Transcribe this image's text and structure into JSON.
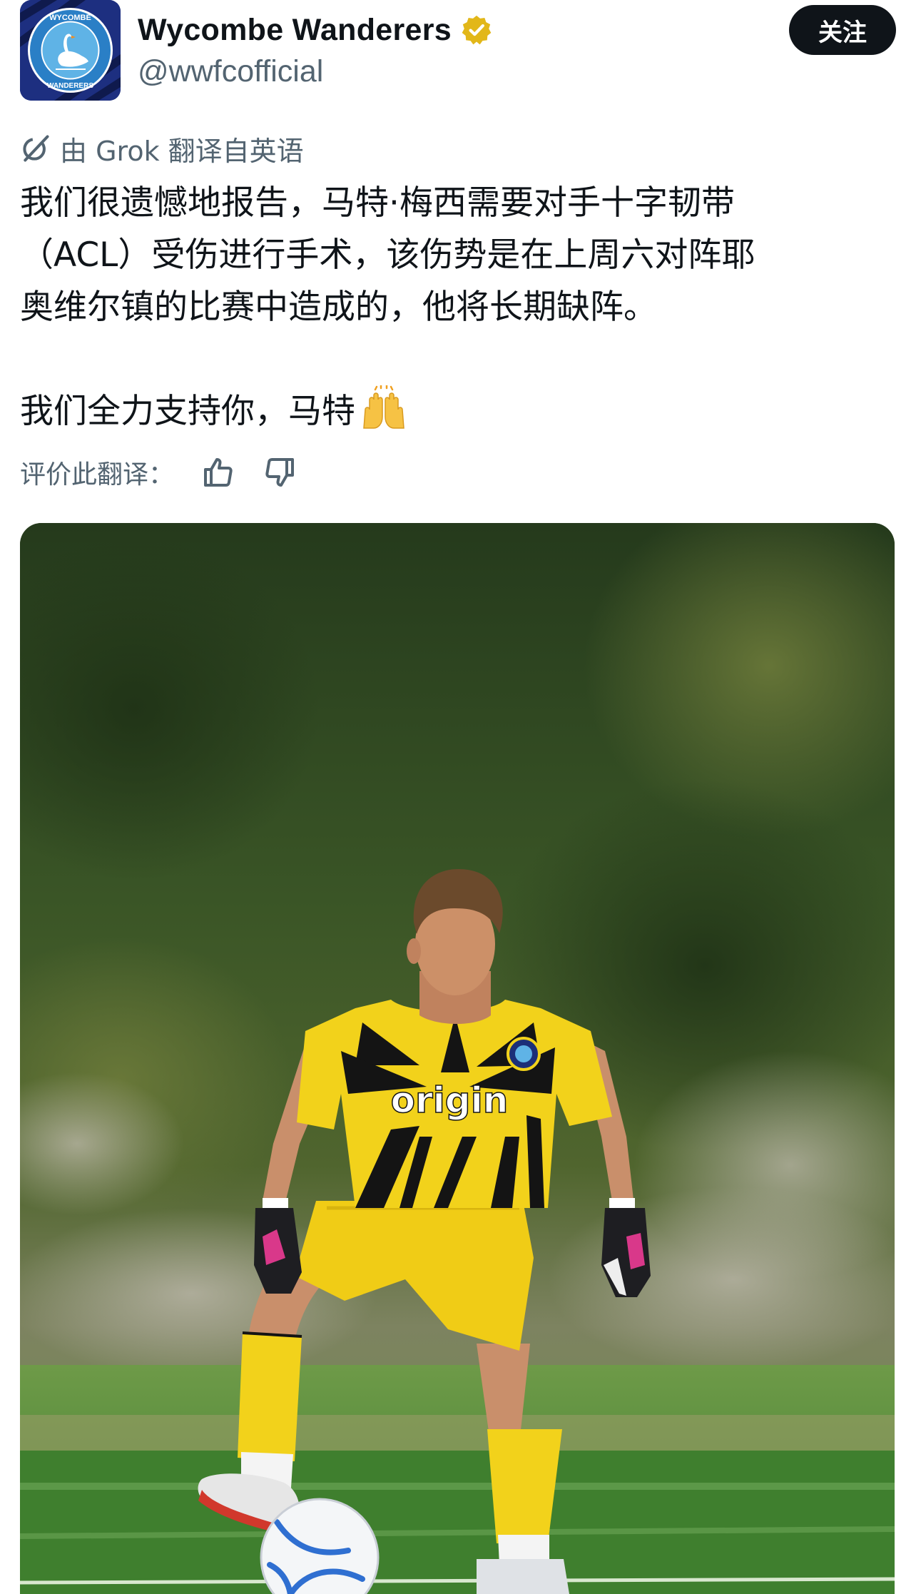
{
  "author": {
    "display_name": "Wycombe Wanderers",
    "handle": "@wwfcofficial",
    "verified": true,
    "avatar_icon": "wycombe-swan-crest",
    "avatar_text_top": "WYCOMBE",
    "avatar_text_bottom": "WANDERERS"
  },
  "follow_button": {
    "label": "关注"
  },
  "translation_notice": {
    "icon": "grok-icon",
    "text": "由 Grok 翻译自英语"
  },
  "tweet": {
    "lines": [
      "我们很遗憾地报告，马特·梅西需要对手十字韧带",
      "（ACL）受伤进行手术，该伤势是在上周六对阵耶",
      "奥维尔镇的比赛中造成的，他将长期缺阵。"
    ],
    "closing_line": "我们全力支持你，马特",
    "closing_emoji": "raising-hands-emoji"
  },
  "rate_translation": {
    "label": "评价此翻译："
  },
  "photo": {
    "description_icon": "goalkeeper-photo",
    "shirt_sponsor": "origin",
    "accent_colors": {
      "kit_yellow": "#f2d21b",
      "kit_black": "#141414",
      "grass": "#4c8a34",
      "trees": "#2f4a22"
    }
  },
  "colors": {
    "text_primary": "#0f1419",
    "text_secondary": "#536471",
    "verified_gold": "#e2b719",
    "follow_bg": "#0f1419"
  }
}
